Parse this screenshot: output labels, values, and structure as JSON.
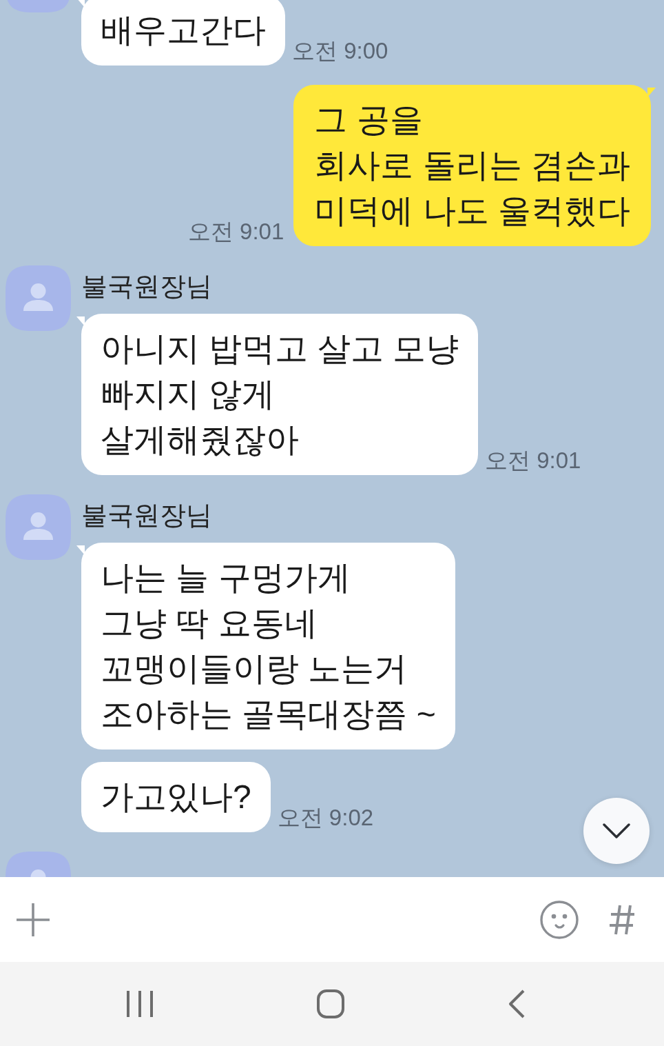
{
  "chat": [
    {
      "kind": "incoming",
      "messages": [
        {
          "text": "배우고간다",
          "time": "오전 9:00"
        }
      ]
    },
    {
      "kind": "outgoing",
      "messages": [
        {
          "text": "그 공을\n회사로 돌리는 겸손과\n미덕에 나도 울컥했다",
          "time": "오전 9:01"
        }
      ]
    },
    {
      "kind": "incoming",
      "sender": "불국원장님",
      "messages": [
        {
          "text": "아니지 밥먹고 살고 모냥\n빠지지 않게\n살게해줬잖아",
          "time": "오전 9:01"
        }
      ]
    },
    {
      "kind": "incoming",
      "sender": "불국원장님",
      "messages": [
        {
          "text": "나는 늘 구멍가게\n그냥 딱 요동네\n꼬맹이들이랑 노는거\n조아하는 골목대장쯤 ~"
        },
        {
          "text": "가고있나?",
          "time": "오전 9:02"
        }
      ]
    },
    {
      "kind": "incoming"
    }
  ]
}
